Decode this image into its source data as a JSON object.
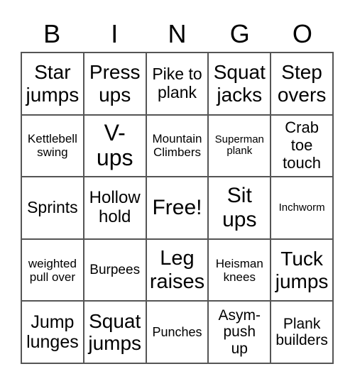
{
  "header": {
    "letters": [
      "B",
      "I",
      "N",
      "G",
      "O"
    ]
  },
  "cells": [
    [
      "Star jumps",
      "Press ups",
      "Pike to plank",
      "Squat jacks",
      "Step overs"
    ],
    [
      "Kettlebell swing",
      "V- ups",
      "Mountain Climbers",
      "Superman plank",
      "Crab toe touch"
    ],
    [
      "Sprints",
      "Hollow hold",
      "Free!",
      "Sit ups",
      "Inchworm"
    ],
    [
      "weighted pull over",
      "Burpees",
      "Leg raises",
      "Heisman knees",
      "Tuck jumps"
    ],
    [
      "Jump lunges",
      "Squat jumps",
      "Punches",
      "Asym- push up",
      "Plank builders"
    ]
  ]
}
